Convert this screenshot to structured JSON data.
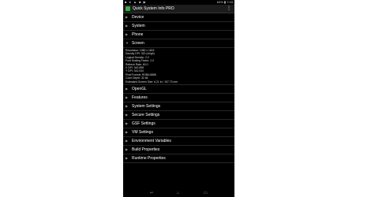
{
  "status_bar": {
    "left_icons": "■ ● ▲ ■ ▶",
    "right_info": "64% ▮ 7:43"
  },
  "app_bar": {
    "title": "Quick System Info PRO",
    "app_icon": "android-icon",
    "overflow_icon": "⋮"
  },
  "sections_top": [
    {
      "label": "Device",
      "expanded": false
    },
    {
      "label": "System",
      "expanded": false
    },
    {
      "label": "Phone",
      "expanded": false
    },
    {
      "label": "Screen",
      "expanded": true
    }
  ],
  "screen_details": [
    "Resolution: 1080 x 1824",
    "Density DPI: 320 (xhigh)",
    "Logical Density: 2.0",
    "Font Scaling Factor: 2.0",
    "Refresh Rate: 60.0",
    "X DPI: 342.898",
    "Y DPI: 341.034",
    "Pixel Format: RGBA 8888",
    "Color Depth: 32 bit",
    "Estimated Screen Size: 6.21 in / 157.73 mm"
  ],
  "sections_bottom": [
    {
      "label": "OpenGL"
    },
    {
      "label": "Features"
    },
    {
      "label": "System Settings"
    },
    {
      "label": "Secure Settings"
    },
    {
      "label": "GSF Settings"
    },
    {
      "label": "VM Settings"
    },
    {
      "label": "Environment Variables"
    },
    {
      "label": "Build Properties"
    },
    {
      "label": "Runtime Properties"
    }
  ],
  "glyphs": {
    "collapsed_arrow": "▶",
    "expanded_arrow": "▼",
    "nav_back": "↩",
    "nav_home": "⌂",
    "nav_recent": "▭"
  }
}
